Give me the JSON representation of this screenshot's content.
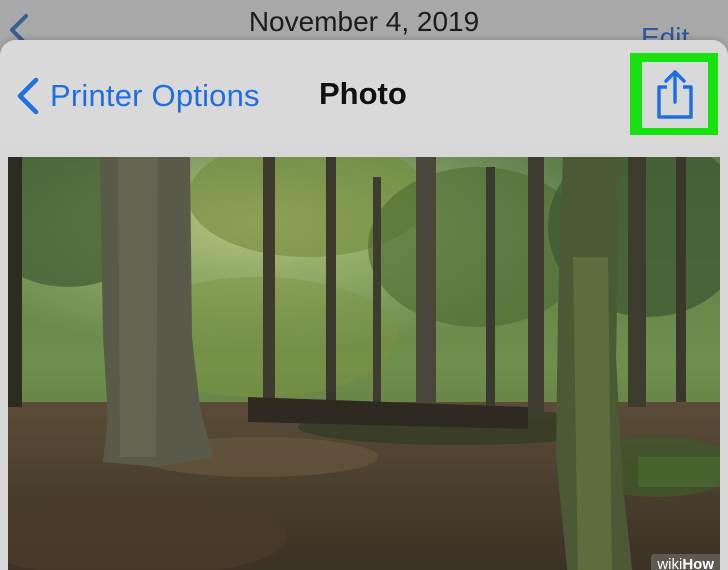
{
  "background_screen": {
    "date_title": "November 4, 2019",
    "edit_label": "Edit"
  },
  "navbar": {
    "back_label": "Printer Options",
    "title": "Photo",
    "share_icon": "share-icon",
    "highlight_color": "#17e20f",
    "accent_color": "#1f6fe0"
  },
  "photo": {
    "subject": "forest-photo"
  },
  "watermark": {
    "wiki": "wiki",
    "how": "How"
  }
}
